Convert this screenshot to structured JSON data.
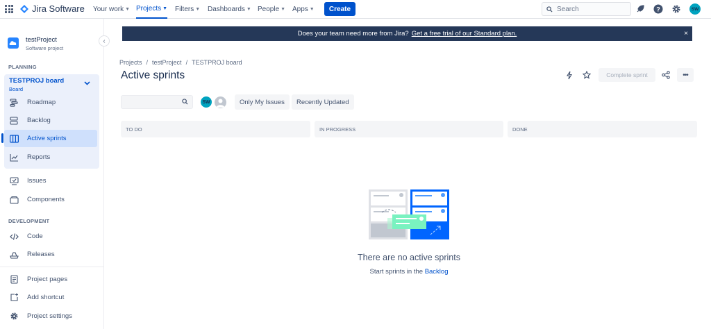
{
  "topnav": {
    "product": "Jira Software",
    "menus": [
      {
        "label": "Your work"
      },
      {
        "label": "Projects"
      },
      {
        "label": "Filters"
      },
      {
        "label": "Dashboards"
      },
      {
        "label": "People"
      },
      {
        "label": "Apps"
      }
    ],
    "create_label": "Create",
    "search_placeholder": "Search",
    "avatar_initials": "SW"
  },
  "sidebar": {
    "project_name": "testProject",
    "project_type": "Software project",
    "planning_title": "PLANNING",
    "board_name": "TESTPROJ board",
    "board_sub": "Board",
    "planning_items": [
      {
        "label": "Roadmap",
        "icon": "roadmap-icon"
      },
      {
        "label": "Backlog",
        "icon": "backlog-icon"
      },
      {
        "label": "Active sprints",
        "icon": "board-columns-icon"
      },
      {
        "label": "Reports",
        "icon": "reports-icon"
      }
    ],
    "other_items": [
      {
        "label": "Issues",
        "icon": "issues-icon"
      },
      {
        "label": "Components",
        "icon": "components-icon"
      }
    ],
    "development_title": "DEVELOPMENT",
    "dev_items": [
      {
        "label": "Code",
        "icon": "code-icon"
      },
      {
        "label": "Releases",
        "icon": "releases-icon"
      }
    ],
    "bottom_items": [
      {
        "label": "Project pages",
        "icon": "pages-icon"
      },
      {
        "label": "Add shortcut",
        "icon": "shortcut-icon"
      },
      {
        "label": "Project settings",
        "icon": "gear-icon"
      }
    ]
  },
  "banner": {
    "text": "Does your team need more from Jira?",
    "link": "Get a free trial of our Standard plan.",
    "close": "×"
  },
  "breadcrumb": [
    "Projects",
    "testProject",
    "TESTPROJ board"
  ],
  "page_title": "Active sprints",
  "header_actions": {
    "complete_label": "Complete sprint",
    "more": "•••"
  },
  "filters": {
    "avatar_initials": "SW",
    "quick_filters": [
      "Only My Issues",
      "Recently Updated"
    ]
  },
  "columns": [
    "TO DO",
    "IN PROGRESS",
    "DONE"
  ],
  "empty_state": {
    "title": "There are no active sprints",
    "sub_prefix": "Start sprints in the",
    "sub_link": "Backlog"
  },
  "colors": {
    "accent": "#0052cc",
    "banner_bg": "#253858",
    "sidebar_highlight": "#ebf0fb"
  }
}
